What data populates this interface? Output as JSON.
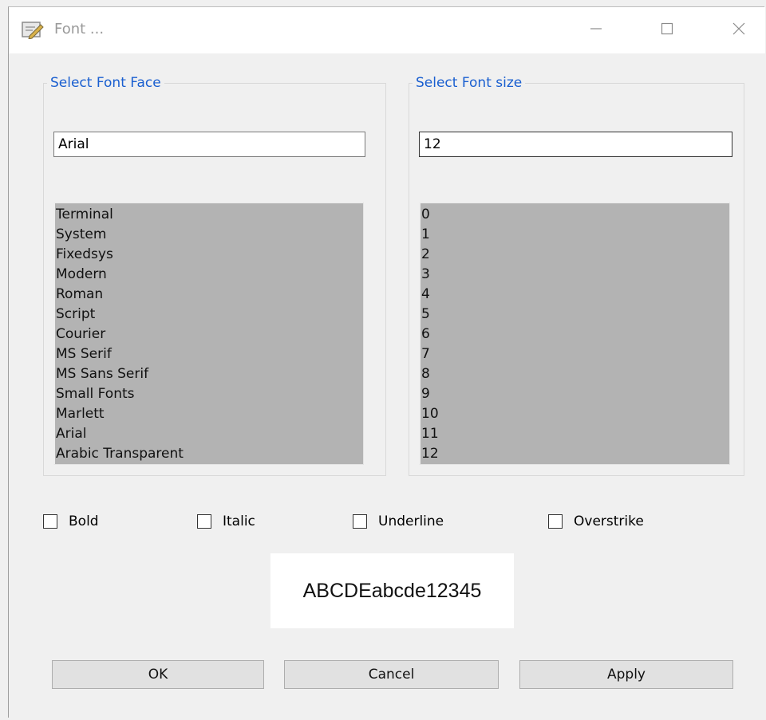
{
  "window": {
    "title": "Font ..."
  },
  "font_face": {
    "group_label": "Select Font Face",
    "value": "Arial",
    "items": [
      "Terminal",
      "System",
      "Fixedsys",
      "Modern",
      "Roman",
      "Script",
      "Courier",
      "MS Serif",
      "MS Sans Serif",
      "Small Fonts",
      "Marlett",
      "Arial",
      "Arabic Transparent"
    ]
  },
  "font_size": {
    "group_label": "Select Font size",
    "value": "12",
    "items": [
      "0",
      "1",
      "2",
      "3",
      "4",
      "5",
      "6",
      "7",
      "8",
      "9",
      "10",
      "11",
      "12"
    ]
  },
  "options": {
    "bold": {
      "label": "Bold",
      "checked": false
    },
    "italic": {
      "label": "Italic",
      "checked": false
    },
    "underline": {
      "label": "Underline",
      "checked": false
    },
    "overstrike": {
      "label": "Overstrike",
      "checked": false
    }
  },
  "preview": {
    "text": "ABCDEabcde12345"
  },
  "buttons": {
    "ok": "OK",
    "cancel": "Cancel",
    "apply": "Apply"
  },
  "colors": {
    "group_label": "#1a5fd0",
    "listbox_bg": "#b3b3b3",
    "button_bg": "#e1e1e1"
  },
  "icons": {
    "app": "edit-icon",
    "minimize": "minimize-icon",
    "maximize": "maximize-icon",
    "close": "close-icon"
  }
}
